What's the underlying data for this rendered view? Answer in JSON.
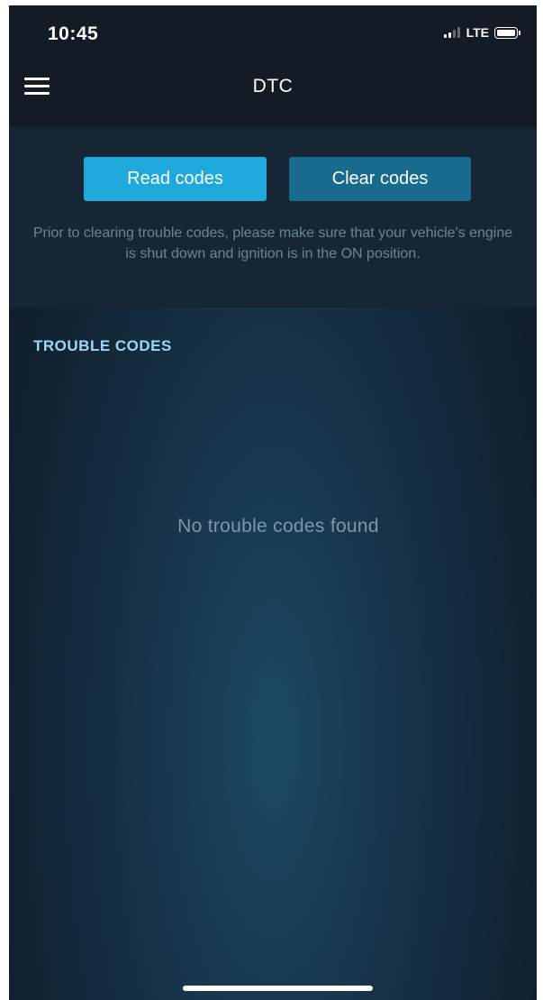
{
  "status_bar": {
    "time": "10:45",
    "network": "LTE",
    "signal_bars_active": 2,
    "signal_bars_total": 4
  },
  "nav": {
    "title": "DTC",
    "menu_icon": "hamburger-menu-icon"
  },
  "actions": {
    "read_label": "Read codes",
    "clear_label": "Clear codes",
    "notice": "Prior to clearing trouble codes, please make sure that your vehicle's engine is shut down and ignition is in the ON position."
  },
  "trouble_codes": {
    "header": "TROUBLE CODES",
    "empty_message": "No trouble codes found",
    "items": []
  },
  "colors": {
    "primary_button": "#1ea8dc",
    "secondary_button": "#176b8f",
    "section_header": "#9cd8f0",
    "top_bar": "#121b26",
    "panel": "#172635"
  }
}
